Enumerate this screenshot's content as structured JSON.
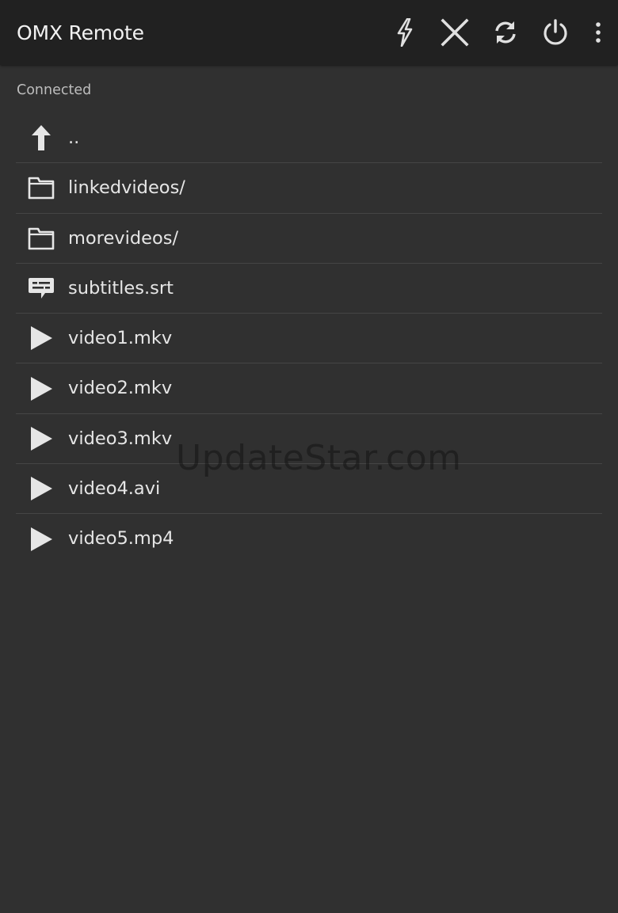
{
  "app": {
    "title": "OMX Remote"
  },
  "toolbar": {
    "actions": [
      {
        "name": "lightning-icon"
      },
      {
        "name": "close-icon"
      },
      {
        "name": "refresh-icon"
      },
      {
        "name": "power-icon"
      },
      {
        "name": "overflow-menu-icon"
      }
    ]
  },
  "status": {
    "text": "Connected"
  },
  "files": [
    {
      "name": "..",
      "icon": "arrow-up-icon"
    },
    {
      "name": "linkedvideos/",
      "icon": "folder-icon"
    },
    {
      "name": "morevideos/",
      "icon": "folder-icon"
    },
    {
      "name": "subtitles.srt",
      "icon": "subtitles-icon"
    },
    {
      "name": "video1.mkv",
      "icon": "play-icon"
    },
    {
      "name": "video2.mkv",
      "icon": "play-icon"
    },
    {
      "name": "video3.mkv",
      "icon": "play-icon"
    },
    {
      "name": "video4.avi",
      "icon": "play-icon"
    },
    {
      "name": "video5.mp4",
      "icon": "play-icon"
    }
  ],
  "watermark": {
    "text": "UpdateStar.com"
  },
  "colors": {
    "background": "#303030",
    "action_bar": "#212121",
    "icon": "#e0e0e0",
    "divider": "#454545"
  }
}
